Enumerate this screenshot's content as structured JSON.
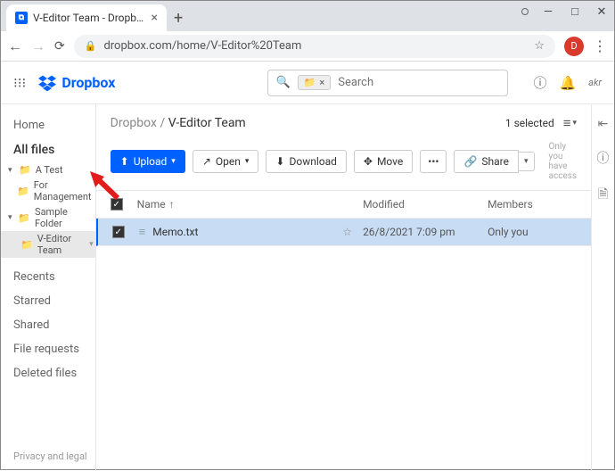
{
  "browser": {
    "tab_title": "V-Editor Team - Dropbox",
    "url": "dropbox.com/home/V-Editor%20Team",
    "avatar_letter": "D"
  },
  "header": {
    "brand": "Dropbox",
    "search_placeholder": "Search",
    "initials": "akr"
  },
  "sidebar": {
    "home": "Home",
    "all_files": "All files",
    "folders": [
      {
        "label": "A Test"
      },
      {
        "label": "For Management"
      },
      {
        "label": "Sample Folder"
      },
      {
        "label": "V-Editor Team",
        "selected": true
      }
    ],
    "recents": "Recents",
    "starred": "Starred",
    "shared": "Shared",
    "file_requests": "File requests",
    "deleted": "Deleted files",
    "footer": "Privacy and legal"
  },
  "breadcrumb": {
    "root": "Dropbox",
    "current": "V-Editor Team",
    "selected_text": "1 selected"
  },
  "toolbar": {
    "upload": "Upload",
    "open": "Open",
    "download": "Download",
    "move": "Move",
    "share": "Share",
    "access": "Only you have access"
  },
  "table": {
    "col_name": "Name",
    "col_modified": "Modified",
    "col_members": "Members",
    "rows": [
      {
        "name": "Memo.txt",
        "modified": "26/8/2021 7:09 pm",
        "members": "Only you"
      }
    ]
  }
}
